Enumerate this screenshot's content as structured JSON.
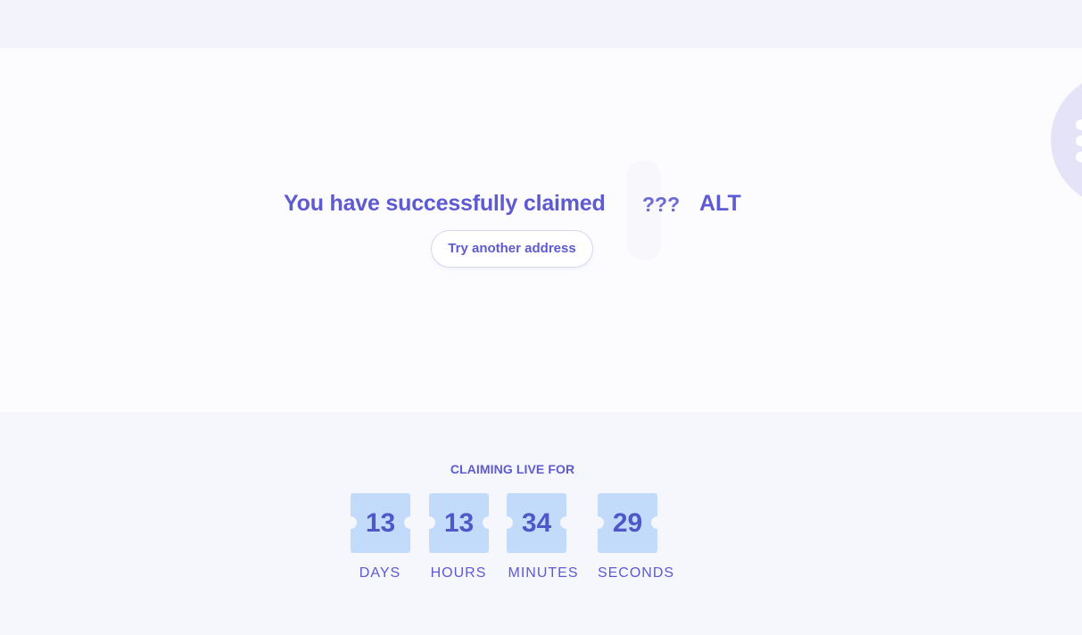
{
  "claim": {
    "message": "You have successfully claimed",
    "amount": "???",
    "token": "ALT",
    "retry_label": "Try another address"
  },
  "countdown": {
    "title": "CLAIMING LIVE FOR",
    "units": [
      {
        "value": "13",
        "label": "DAYS"
      },
      {
        "value": "13",
        "label": "HOURS"
      },
      {
        "value": "34",
        "label": "MINUTES"
      },
      {
        "value": "29",
        "label": "SECONDS"
      }
    ]
  },
  "colors": {
    "accent": "#5e5ad0",
    "ticket": "#c2dbfb",
    "hero_background": "#fcfcff",
    "section_background": "#f6f6fd",
    "decor_circle": "#e4e3f7"
  }
}
